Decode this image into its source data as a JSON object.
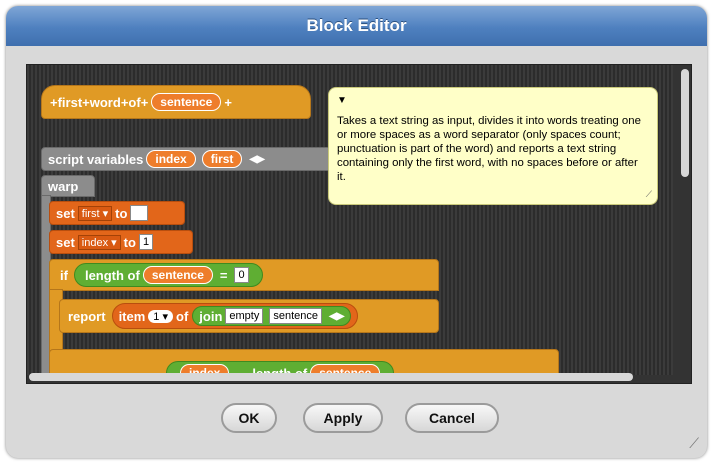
{
  "window": {
    "title": "Block Editor"
  },
  "hat_block": {
    "plus1": "+",
    "word_first": "first",
    "plus2": "+",
    "word_word": "word",
    "plus3": "+",
    "word_of": "of",
    "plus4": "+",
    "param": "sentence",
    "plus5": "+"
  },
  "script_vars": {
    "label": "script variables",
    "var1": "index",
    "var2": "first"
  },
  "warp": {
    "label": "warp"
  },
  "set1": {
    "label": "set",
    "var": "first",
    "to": "to",
    "value": ""
  },
  "set2": {
    "label": "set",
    "var": "index",
    "to": "to",
    "value": "1"
  },
  "if_block": {
    "label": "if",
    "length_label": "length of",
    "arg": "sentence",
    "eq": "=",
    "value": "0"
  },
  "report": {
    "label": "report",
    "item": "item",
    "item_value": "1",
    "of": "of",
    "join": "join",
    "join_arg1": "empty",
    "join_arg2": "sentence"
  },
  "partial_row": {
    "a": "index",
    "b": "length of",
    "c": "sentence"
  },
  "comment": {
    "text": "Takes a text string as input, divides it into words treating one or more spaces as a word separator (only spaces count; punctuation is part of the word) and reports a text string containing only the first word, with no spaces before or after it."
  },
  "buttons": {
    "ok": "OK",
    "apply": "Apply",
    "cancel": "Cancel"
  },
  "colors": {
    "title_blue": "#4e80bf",
    "orange": "#e2661a",
    "gold": "#e09a25",
    "green": "#5fae33",
    "note_yellow": "#ffffc8"
  }
}
